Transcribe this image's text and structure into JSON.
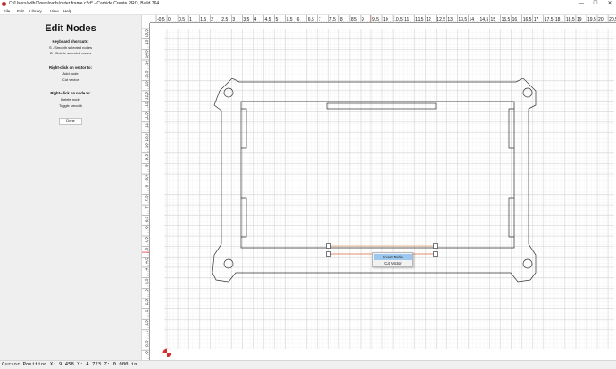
{
  "window": {
    "title": "C:/Users/wilb/Downloads/outer frame.c2d* - Carbide Create PRO, Build 764",
    "controls": {
      "minimize": "—",
      "maximize": "☐",
      "close": "✕"
    }
  },
  "menu": [
    "File",
    "Edit",
    "Library",
    "View",
    "Help"
  ],
  "panel": {
    "title": "Edit Nodes",
    "keyboard_heading": "Keyboard shortcuts:",
    "keyboard_lines": [
      "S - Smooth selected nodes",
      "D - Delete selected nodes"
    ],
    "vector_heading": "Right-click on vector to:",
    "vector_lines": [
      "Add node",
      "Cut vector"
    ],
    "node_heading": "Right-click on node to:",
    "node_lines": [
      "Delete node",
      "Toggle smooth"
    ],
    "done_label": "Done"
  },
  "rulers": {
    "x_labels": [
      "-0.5",
      "0",
      "0.5",
      "1",
      "1.5",
      "2",
      "2.5",
      "3",
      "3.5",
      "4",
      "4.5",
      "5",
      "5.5",
      "6",
      "6.5",
      "7",
      "7.5",
      "8",
      "8.5",
      "9",
      "9.5",
      "10",
      "10.5",
      "11",
      "11.5",
      "12",
      "12.5",
      "13",
      "13.5",
      "14",
      "14.5",
      "15",
      "15.5",
      "16",
      "16.5",
      "17",
      "17.5",
      "18",
      "18.5",
      "19",
      "19.5",
      "20",
      "20.5"
    ],
    "y_labels": [
      "15.5",
      "15",
      "14.5",
      "14",
      "13.5",
      "13",
      "12.5",
      "12",
      "11.5",
      "11",
      "10.5",
      "10",
      "9.5",
      "9",
      "8.5",
      "8",
      "7.5",
      "7",
      "6.5",
      "6",
      "5.5",
      "5",
      "4.5",
      "4",
      "3.5",
      "3",
      "2.5",
      "2",
      "1.5",
      "1",
      "0.5",
      "0"
    ],
    "cursor_x_value": 9.458,
    "cursor_y_value": 4.723
  },
  "context_menu": {
    "items": [
      "Insert Node",
      "Cut Vector"
    ],
    "selected": "Insert Node"
  },
  "status": {
    "text": "Cursor Position X: 9.458 Y: 4.723 Z: 0.000 in"
  },
  "colors": {
    "selection_orange": "#e6a06a",
    "ruler_marker": "#e53935",
    "menu_highlight": "#9cc8ef",
    "origin_red": "#d32f2f"
  }
}
